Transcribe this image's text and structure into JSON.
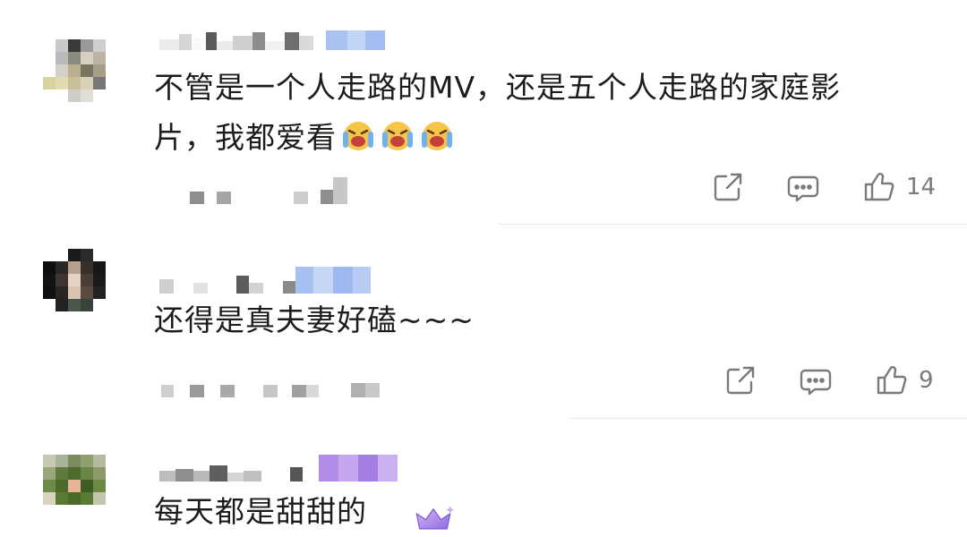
{
  "comments": [
    {
      "text_line1": "不管是一个人走路的MV，还是五个人走路的家庭影",
      "text_line2": "片，我都爱看",
      "emoji_count": 3,
      "emoji_icon": "laughing-crying-emoji-icon",
      "likes": "14"
    },
    {
      "text_line1": "还得是真夫妻好磕~~~",
      "likes": "9"
    },
    {
      "text_line1": "每天都是甜甜的",
      "badge_icon": "purple-crown-badge-icon"
    }
  ],
  "icons": {
    "share": "share-icon",
    "comment": "comment-icon",
    "like": "thumbs-up-icon"
  },
  "colors": {
    "action_gray": "#7a7a7a",
    "divider": "#e9e9e9",
    "name_blue": "#a9c2f2",
    "name_purple": "#b18be8"
  }
}
